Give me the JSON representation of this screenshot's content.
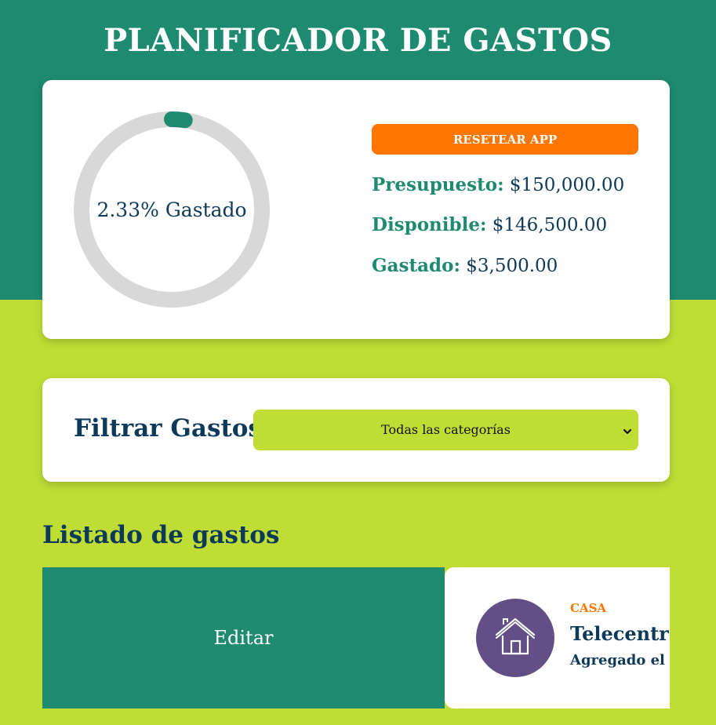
{
  "app": {
    "title": "PLANIFICADOR DE GASTOS"
  },
  "budget": {
    "progress_text": "2.33% Gastado",
    "progress_percent": 2.33,
    "reset_label": "RESETEAR APP",
    "presupuesto_label": "Presupuesto:",
    "presupuesto_value": "$150,000.00",
    "disponible_label": "Disponible:",
    "disponible_value": "$146,500.00",
    "gastado_label": "Gastado:",
    "gastado_value": "$3,500.00"
  },
  "filter": {
    "label": "Filtrar Gastos",
    "selected": "Todas las categorías"
  },
  "expenses": {
    "title": "Listado de gastos",
    "edit_label": "Editar",
    "items": [
      {
        "category": "CASA",
        "icon": "house-icon",
        "name": "Telecentro",
        "date": "Agregado el día"
      }
    ]
  },
  "colors": {
    "primary_green": "#1e8a70",
    "lime": "#bfdd35",
    "orange": "#ff7600",
    "navy": "#0e3a5a",
    "purple": "#634f86",
    "track_gray": "#d8d8d8"
  }
}
